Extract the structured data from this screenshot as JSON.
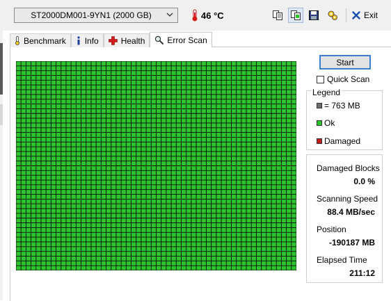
{
  "toolbar": {
    "drive": "ST2000DM001-9YN1 (2000 GB)",
    "temperature": "46 °C",
    "exit_label": "Exit"
  },
  "tabs": [
    {
      "label": "Benchmark",
      "icon": "thermometer-icon"
    },
    {
      "label": "Info",
      "icon": "info-icon"
    },
    {
      "label": "Health",
      "icon": "health-cross-icon"
    },
    {
      "label": "Error Scan",
      "icon": "magnifier-icon",
      "active": true
    }
  ],
  "scan": {
    "columns": 56,
    "rows": 44,
    "ok_color": "#2ec42e",
    "grid_color": "#0a0a0a",
    "damaged_count": 0
  },
  "controls": {
    "start_label": "Start",
    "quick_scan_label": "Quick Scan",
    "quick_scan_checked": false
  },
  "legend": {
    "title": "Legend",
    "block_size": "= 763 MB",
    "ok_label": "Ok",
    "damaged_label": "Damaged",
    "block_color": "#6f6f6f",
    "ok_color": "#2ec42e",
    "damaged_color": "#c41d1d"
  },
  "stats": {
    "damaged_blocks_label": "Damaged Blocks",
    "damaged_blocks_value": "0.0 %",
    "speed_label": "Scanning Speed",
    "speed_value": "88.4 MB/sec",
    "position_label": "Position",
    "position_value": "-190187 MB",
    "elapsed_label": "Elapsed Time",
    "elapsed_value": "211:12"
  }
}
